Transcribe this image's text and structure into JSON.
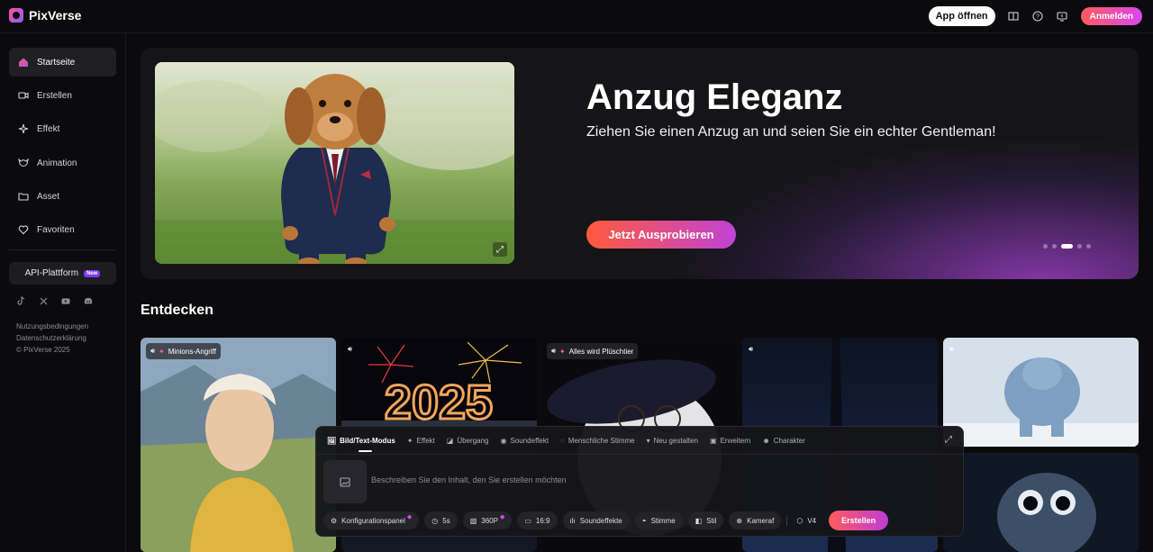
{
  "app": {
    "name": "PixVerse"
  },
  "topbar": {
    "open_app_label": "App öffnen",
    "login_label": "Anmelden"
  },
  "sidebar": {
    "items": [
      {
        "label": "Startseite",
        "icon": "home-icon"
      },
      {
        "label": "Erstellen",
        "icon": "video-icon"
      },
      {
        "label": "Effekt",
        "icon": "sparkle-icon"
      },
      {
        "label": "Animation",
        "icon": "animation-icon"
      },
      {
        "label": "Asset",
        "icon": "folder-icon"
      },
      {
        "label": "Favoriten",
        "icon": "heart-icon"
      }
    ],
    "api_label": "API-Plattform",
    "api_badge": "New",
    "footer": [
      "Nutzungsbedingungen",
      "Datenschutzerklärung",
      "© PixVerse 2025"
    ]
  },
  "hero": {
    "title": "Anzug Eleganz",
    "subtitle": "Ziehen Sie einen Anzug an und seien Sie ein echter Gentleman!",
    "cta": "Jetzt Ausprobieren",
    "active_slide": 3,
    "slide_count": 5
  },
  "discover": {
    "title": "Entdecken",
    "cards": [
      {
        "tag": "Minions-Angriff"
      },
      {
        "tag": ""
      },
      {
        "tag": "Alles wird Plüschtier"
      },
      {
        "tag": ""
      },
      {
        "tag": ""
      }
    ]
  },
  "composer": {
    "tabs": [
      "Bild/Text-Modus",
      "Effekt",
      "Übergang",
      "Soundeffekt",
      "Menschliche Stimme",
      "Neu gestalten",
      "Erweitern",
      "Charakter"
    ],
    "placeholder": "Beschreiben Sie den Inhalt, den Sie erstellen möchten",
    "options": {
      "config": "Konfigurationspanel",
      "duration": "5s",
      "resolution": "360P",
      "ratio": "16:9",
      "sfx": "Soundeffekte",
      "voice": "Stimme",
      "style": "Stil",
      "camera": "Kameraf",
      "model": "V4"
    },
    "create_label": "Erstellen"
  },
  "colors": {
    "accent_gradient_start": "#ff5b5b",
    "accent_gradient_end": "#d946ef",
    "background": "#0b0b0d"
  }
}
